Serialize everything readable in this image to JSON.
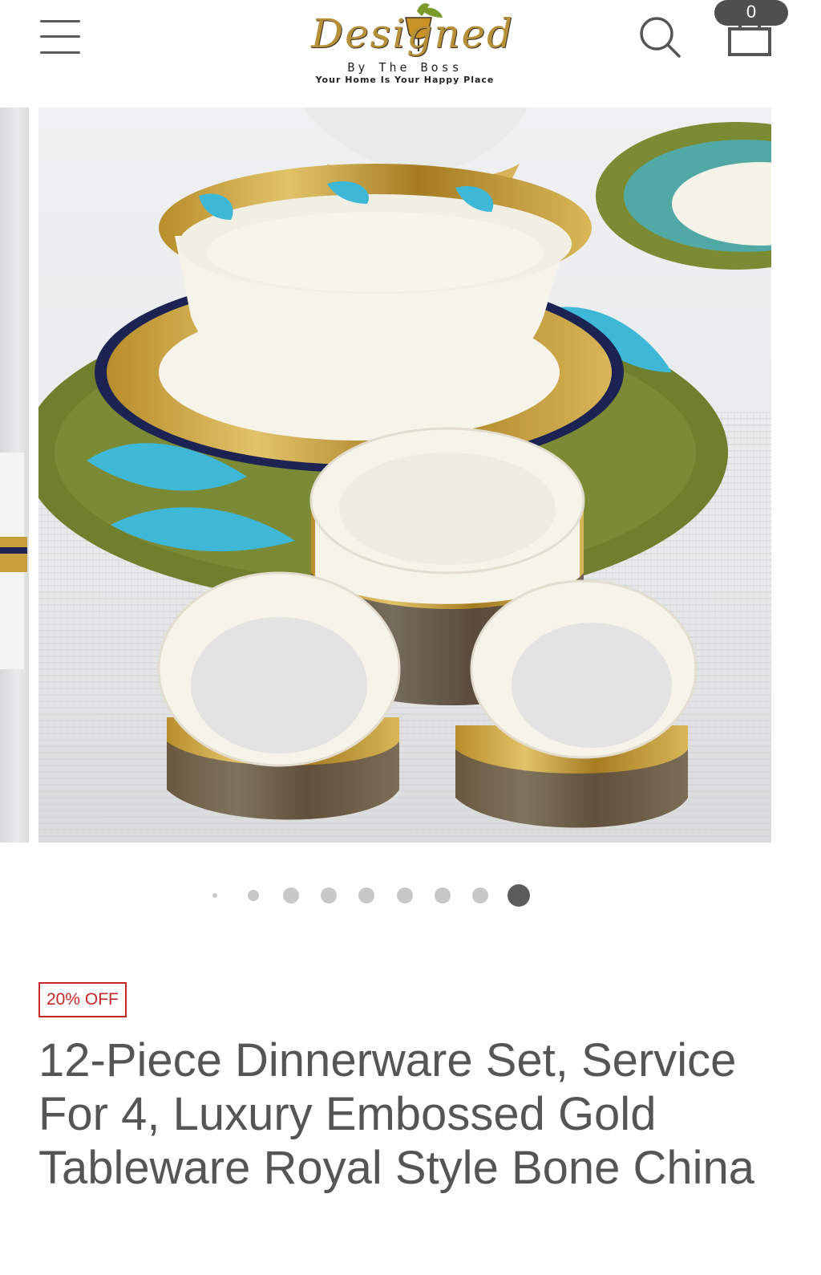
{
  "header": {
    "menu_icon": "hamburger-menu-icon",
    "logo": {
      "script_text": "Designed",
      "sub_text": "By The Boss",
      "tagline": "Your Home Is Your Happy Place",
      "brand_color": "#b8903a"
    },
    "search_icon": "search-icon",
    "cart_icon": "shopping-bag-icon",
    "cart_count": "0"
  },
  "gallery": {
    "slide_count": 9,
    "active_slide": 9,
    "image_subject": "napkin rings and embossed gold turquoise china plates",
    "colors": {
      "gold": "#c9a545",
      "turquoise": "#3fb7d6",
      "navy": "#1c2353",
      "olive": "#7d8a35",
      "cream": "#f6f3ea"
    }
  },
  "product": {
    "badge": "20% OFF",
    "badge_color": "#c62828",
    "title": "12-Piece Dinnerware Set, Service For 4, Luxury Embossed Gold Tableware Royal Style Bone China"
  }
}
